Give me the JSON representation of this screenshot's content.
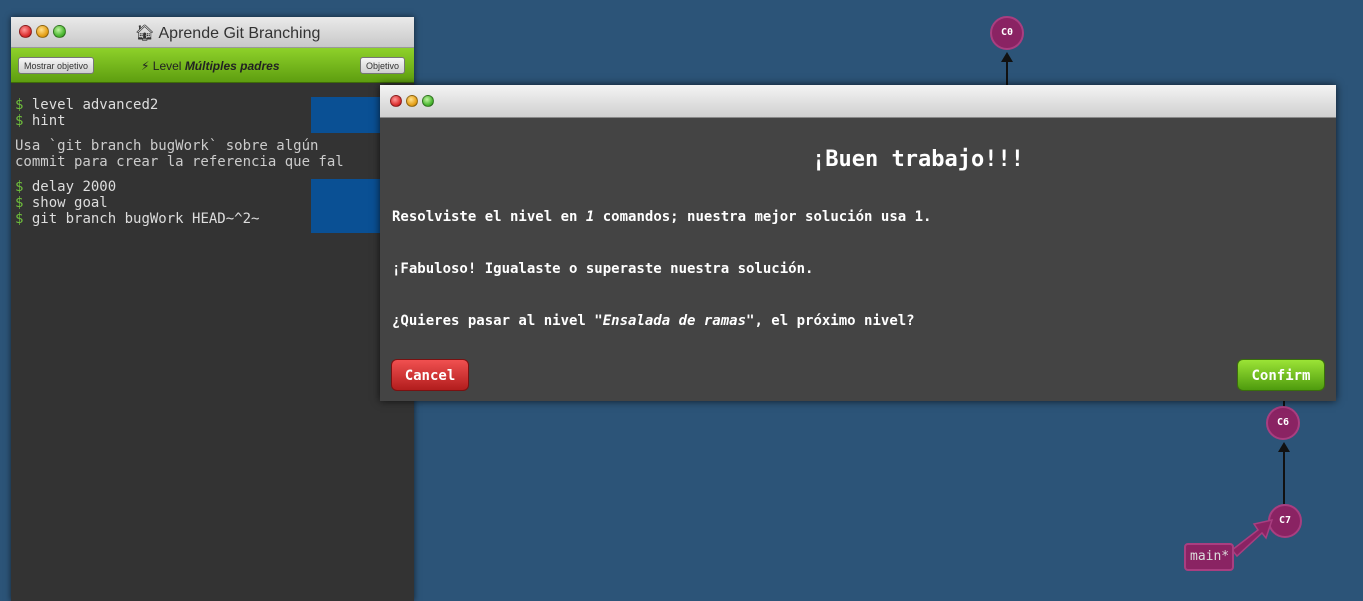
{
  "window": {
    "title": "Aprende Git Branching",
    "home_icon": "home-icon"
  },
  "toolbar": {
    "show_goal_label": "Mostrar objetivo",
    "level_prefix": "Level",
    "level_name": "Múltiples padres",
    "objective_label": "Objetivo",
    "level_icon": "lightning-icon"
  },
  "terminal": {
    "block1": [
      "level advanced2",
      "hint"
    ],
    "hint_lines": [
      "Usa `git branch bugWork` sobre algún",
      "commit para crear la referencia que fal"
    ],
    "block2": [
      "delay 2000",
      "show goal",
      "git branch bugWork HEAD~^2~"
    ],
    "prompt": "$"
  },
  "tree": {
    "nodes": [
      "C0",
      "C6",
      "C7"
    ],
    "branch": "main*"
  },
  "modal": {
    "heading": "¡Buen trabajo!!!",
    "line1_pre": "Resolviste el nivel en ",
    "line1_num": "1",
    "line1_post": " comandos; nuestra mejor solución usa 1.",
    "line2": "¡Fabuloso! Igualaste o superaste nuestra solución.",
    "line3_pre": "¿Quieres pasar al nivel ",
    "line3_level": "\"Ensalada de ramas\"",
    "line3_post": ", el próximo nivel?",
    "cancel_label": "Cancel",
    "confirm_label": "Confirm"
  },
  "colors": {
    "background": "#2c5478",
    "toolbar_green": "#8ed12a",
    "commit_node": "#8a2363",
    "cancel_red": "#d33333",
    "confirm_green": "#6fbf1f"
  }
}
